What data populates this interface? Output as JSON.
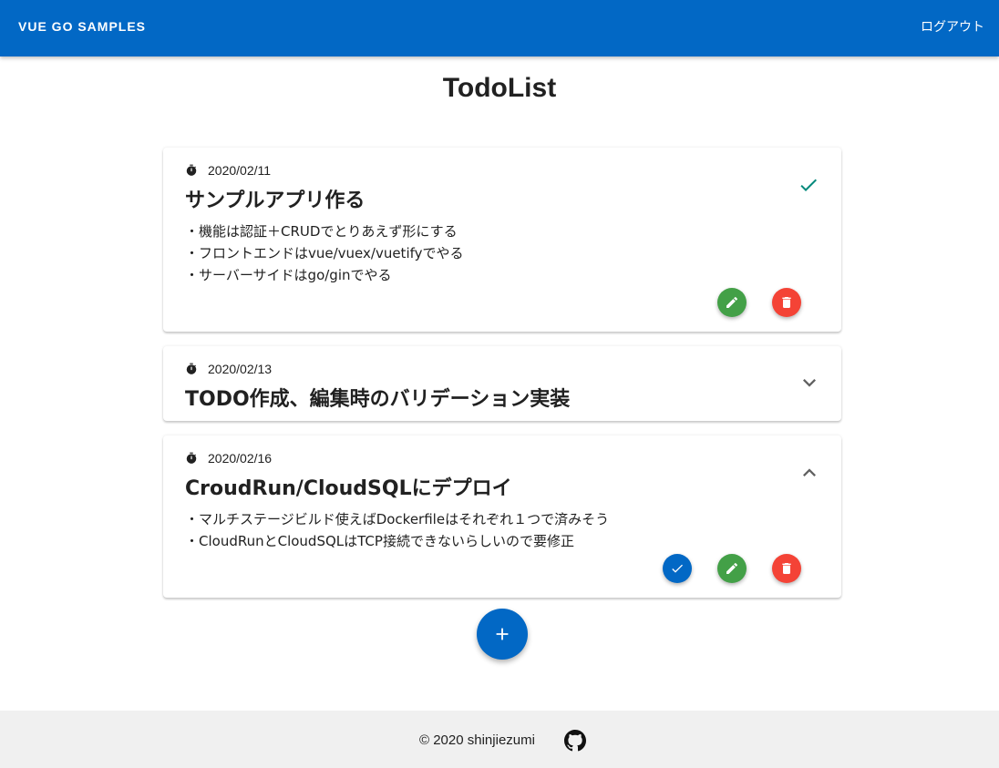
{
  "app_bar": {
    "title": "VUE GO SAMPLES",
    "logout_label": "ログアウト",
    "color": "#0268c5"
  },
  "page": {
    "title": "TodoList"
  },
  "todos": [
    {
      "date": "2020/02/11",
      "title": "サンプルアプリ作る",
      "body": "・機能は認証＋CRUDでとりあえず形にする\n・フロントエンドはvue/vuex/vuetifyでやる\n・サーバーサイドはgo/ginでやる",
      "status_icon": "check-icon",
      "expanded": true,
      "actions": [
        "edit-icon",
        "delete-icon"
      ]
    },
    {
      "date": "2020/02/13",
      "title": "TODO作成、編集時のバリデーション実装",
      "status_icon": "chevron-down-icon",
      "expanded": false
    },
    {
      "date": "2020/02/16",
      "title": "CroudRun/CloudSQLにデプロイ",
      "body": "・マルチステージビルド使えばDockerfileはそれぞれ１つで済みそう\n・CloudRunとCloudSQLはTCP接続できないらしいので要修正",
      "status_icon": "chevron-up-icon",
      "expanded": true,
      "actions": [
        "complete-icon",
        "edit-icon",
        "delete-icon"
      ]
    }
  ],
  "colors": {
    "check": "#00897b",
    "edit": "#43a047",
    "delete": "#f44336",
    "complete": "#0268c5"
  },
  "footer": {
    "copyright": "© 2020 shinjiezumi",
    "icon": "github-icon"
  }
}
